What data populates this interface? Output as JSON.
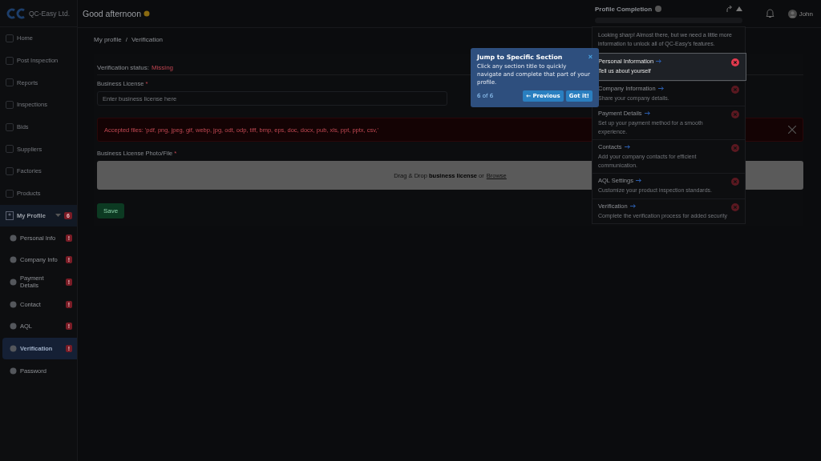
{
  "header": {
    "company": "QC-Easy Ltd.",
    "greeting": "Good afternoon",
    "user": "John"
  },
  "sidebar": {
    "items": [
      {
        "label": "Home",
        "selected": false
      },
      {
        "label": "Post Inspection",
        "selected": false
      },
      {
        "label": "Reports",
        "selected": false
      },
      {
        "label": "Inspections",
        "selected": false
      },
      {
        "label": "Bids",
        "selected": false
      },
      {
        "label": "Suppliers",
        "selected": false
      },
      {
        "label": "Factories",
        "selected": false
      },
      {
        "label": "Products",
        "selected": false
      },
      {
        "label": "My Profile",
        "selected": false,
        "expanded": true,
        "badge": "6",
        "children": [
          {
            "label": "Personal Info",
            "selected": false,
            "badge": "!"
          },
          {
            "label": "Company Info",
            "selected": false,
            "badge": "!"
          },
          {
            "label": "Payment Details",
            "selected": false,
            "badge": "!"
          },
          {
            "label": "Contact",
            "selected": false,
            "badge": "!"
          },
          {
            "label": "AQL",
            "selected": false,
            "badge": "!"
          },
          {
            "label": "Verification",
            "selected": true,
            "badge": "!"
          },
          {
            "label": "Password",
            "selected": false
          }
        ]
      }
    ]
  },
  "breadcrumb": {
    "items": [
      "My profile",
      "Verification"
    ],
    "separator": "/"
  },
  "form": {
    "required_mark": "*",
    "status_label": "Verification status:",
    "status_value": "Missing",
    "license_label": "Business License",
    "license_placeholder": "Enter business license here",
    "alert": "Accepted files: 'pdf, png, jpeg, gif, webp, jpg, odt, odp, tiff, bmp, eps, doc, docx, pub, xls, ppt, pptx, csv,'",
    "upload_label": "Business License Photo/File",
    "upload_text": "Drag & Drop **business license** or",
    "upload_link": "Browse",
    "save": "Save"
  },
  "profile_completion": {
    "title": "Profile Completion",
    "intro": "Looking sharp! Almost there, but we need a little more information to unlock all of QC-Easy's features.",
    "sections": [
      {
        "title": "Personal Information",
        "description": "Tell us about yourself",
        "highlighted": true,
        "done": false
      },
      {
        "title": "Company Information",
        "description": "Share your company details.",
        "highlighted": false,
        "done": false
      },
      {
        "title": "Payment Details",
        "description": "Set up your payment method for a smooth experience.",
        "highlighted": false,
        "done": false
      },
      {
        "title": "Contacts",
        "description": "Add your company contacts for efficient communication.",
        "highlighted": false,
        "done": false
      },
      {
        "title": "AQL Settings",
        "description": "Customize your product inspection standards.",
        "highlighted": false,
        "done": false
      },
      {
        "title": "Verification",
        "description": "Complete the verification process for added security",
        "highlighted": false,
        "done": false
      }
    ]
  },
  "tour": {
    "title": "Jump to Specific Section",
    "text": "Click any section title to quickly navigate and complete that part of your profile.",
    "step": "6 of 6",
    "previous": "← Previous",
    "done": "Got it!",
    "close": "×"
  }
}
